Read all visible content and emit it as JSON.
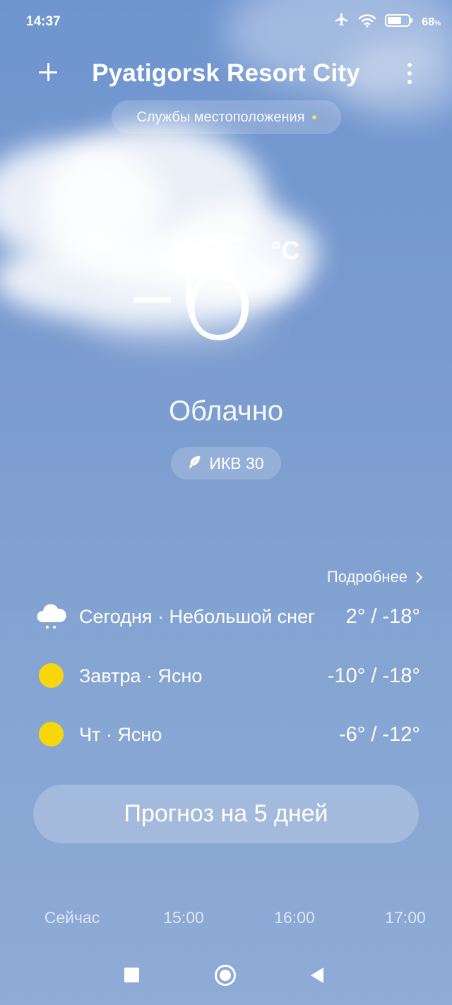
{
  "status_bar": {
    "time": "14:37",
    "battery_percent": "68",
    "battery_unit": "%",
    "battery_level": 0.68,
    "icons": [
      "airplane-icon",
      "wifi-icon",
      "battery-icon"
    ]
  },
  "header": {
    "city": "Pyatigorsk Resort City",
    "add_icon": "plus-icon",
    "menu_icon": "more-vertical-icon"
  },
  "location_services": {
    "label": "Службы местоположения",
    "indicator_color": "#f4dd55"
  },
  "current": {
    "temperature": "-6",
    "unit": "°C",
    "condition": "Облачно"
  },
  "aqi": {
    "label": "ИКВ 30",
    "icon": "leaf-icon"
  },
  "details_link": {
    "label": "Подробнее"
  },
  "daily": [
    {
      "label": "Сегодня · Небольшой снег",
      "temps": "2° / -18°",
      "icon": "light-snow-icon"
    },
    {
      "label": "Завтра · Ясно",
      "temps": "-10° / -18°",
      "icon": "sun-icon"
    },
    {
      "label": "Чт · Ясно",
      "temps": "-6° / -12°",
      "icon": "sun-icon"
    }
  ],
  "forecast_button": {
    "label": "Прогноз на 5 дней"
  },
  "hourly": [
    {
      "time": "Сейчас"
    },
    {
      "time": "15:00"
    },
    {
      "time": "16:00"
    },
    {
      "time": "17:00"
    }
  ],
  "colors": {
    "sky_top": "#6f95cf",
    "sky_bottom": "#8fabd6",
    "sun": "#f8d70a"
  }
}
